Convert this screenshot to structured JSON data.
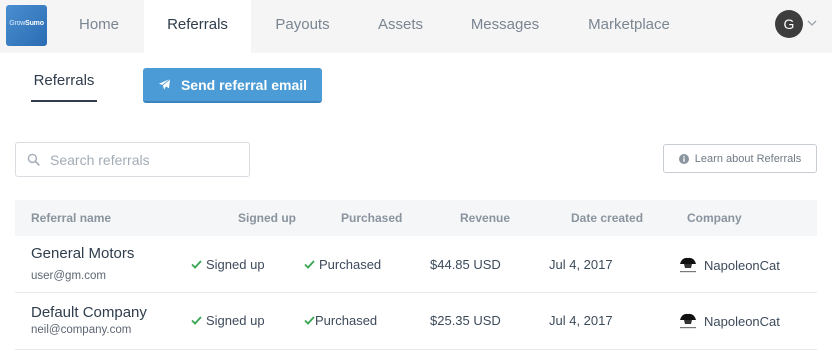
{
  "logo": {
    "text_left": "Grow",
    "text_right": "Sumo"
  },
  "nav": {
    "items": [
      {
        "label": "Home",
        "active": false
      },
      {
        "label": "Referrals",
        "active": true
      },
      {
        "label": "Payouts",
        "active": false
      },
      {
        "label": "Assets",
        "active": false
      },
      {
        "label": "Messages",
        "active": false
      },
      {
        "label": "Marketplace",
        "active": false
      }
    ],
    "avatar_initial": "G"
  },
  "subnav": {
    "tab_label": "Referrals",
    "send_button_label": "Send referral email"
  },
  "search": {
    "placeholder": "Search referrals",
    "value": ""
  },
  "learn_button_label": "Learn about Referrals",
  "table": {
    "columns": [
      "Referral name",
      "Signed up",
      "Purchased",
      "Revenue",
      "Date created",
      "Company"
    ],
    "rows": [
      {
        "name": "General Motors",
        "email": "user@gm.com",
        "signed_up": "Signed up",
        "purchased": "Purchased",
        "revenue": "$44.85 USD",
        "date_created": "Jul 4, 2017",
        "company": "NapoleonCat"
      },
      {
        "name": "Default Company",
        "email": "neil@company.com",
        "signed_up": "Signed up",
        "purchased": "Purchased",
        "revenue": "$25.35 USD",
        "date_created": "Jul 4, 2017",
        "company": "NapoleonCat"
      }
    ]
  },
  "colors": {
    "accent": "#4a9bd6",
    "check_green": "#3aa757",
    "nav_bg": "#f5f5f5",
    "avatar_bg": "#3d3d3d"
  },
  "icons": {
    "send": "paper-plane-icon",
    "search": "search-icon",
    "info": "info-circle-icon",
    "check": "check-icon",
    "caret": "chevron-down-icon",
    "company": "napoleoncat-logo-icon"
  }
}
